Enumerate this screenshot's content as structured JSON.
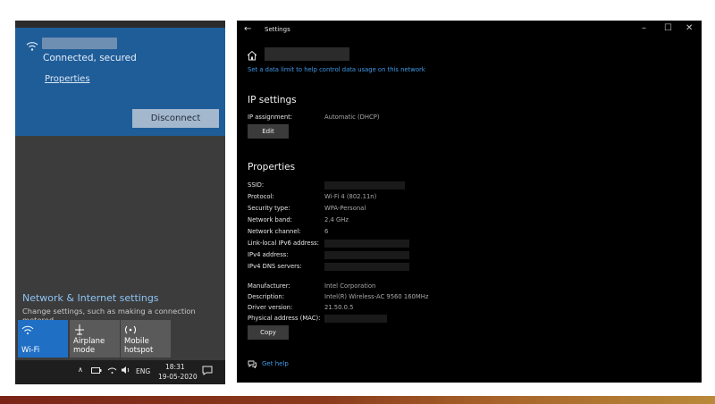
{
  "flyout": {
    "status": "Connected, secured",
    "properties_link": "Properties",
    "disconnect_label": "Disconnect",
    "settings_link": "Network & Internet settings",
    "settings_desc": "Change settings, such as making a connection metered.",
    "tiles": [
      {
        "label": "Wi-Fi",
        "icon": "wifi-icon",
        "active": true
      },
      {
        "label": "Airplane mode",
        "icon": "airplane-icon",
        "active": false
      },
      {
        "label": "Mobile\nhotspot",
        "icon": "hotspot-icon",
        "active": false
      }
    ]
  },
  "taskbar": {
    "chevron": "∧",
    "language": "ENG",
    "time": "18:31",
    "date": "19-05-2020"
  },
  "settings": {
    "title": "Settings",
    "data_limit_link": "Set a data limit to help control data usage on this network",
    "ip_section": "IP settings",
    "ip_assignment_label": "IP assignment:",
    "ip_assignment_value": "Automatic (DHCP)",
    "edit_label": "Edit",
    "props_section": "Properties",
    "properties": [
      {
        "label": "SSID:",
        "value": ""
      },
      {
        "label": "Protocol:",
        "value": "Wi-Fi 4 (802.11n)"
      },
      {
        "label": "Security type:",
        "value": "WPA-Personal"
      },
      {
        "label": "Network band:",
        "value": "2.4 GHz"
      },
      {
        "label": "Network channel:",
        "value": "6"
      },
      {
        "label": "Link-local IPv6 address:",
        "value": ""
      },
      {
        "label": "IPv4 address:",
        "value": ""
      },
      {
        "label": "IPv4 DNS servers:",
        "value": ""
      }
    ],
    "hardware": [
      {
        "label": "Manufacturer:",
        "value": "Intel Corporation"
      },
      {
        "label": "Description:",
        "value": "Intel(R) Wireless-AC 9560 160MHz"
      },
      {
        "label": "Driver version:",
        "value": "21.50.0.5"
      },
      {
        "label": "Physical address (MAC):",
        "value": ""
      }
    ],
    "copy_label": "Copy",
    "get_help": "Get help"
  },
  "colors": {
    "accent_blue": "#1f5d99",
    "tile_active": "#1f6fc5",
    "link": "#3f9ae8"
  }
}
